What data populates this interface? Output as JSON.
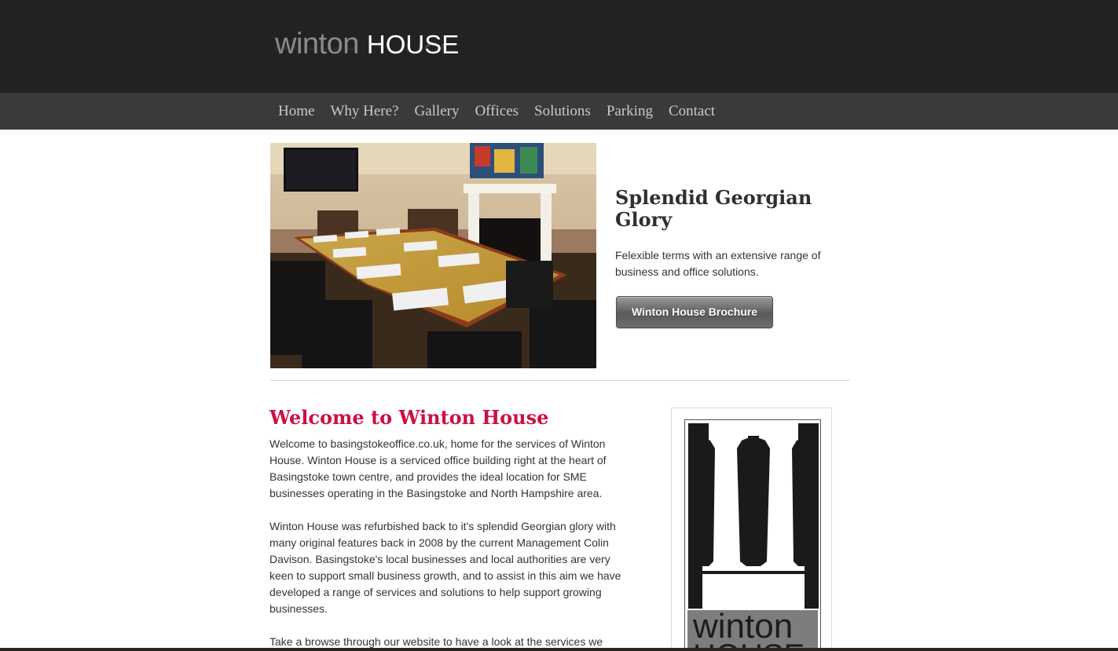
{
  "header": {
    "logo_word1": "winton",
    "logo_word2": "HOUSE"
  },
  "nav": {
    "items": [
      "Home",
      "Why Here?",
      "Gallery",
      "Offices",
      "Solutions",
      "Parking",
      "Contact"
    ]
  },
  "hero": {
    "title": "Splendid Georgian Glory",
    "text": "Felexible terms with an extensive range of business and office solutions.",
    "button_label": "Winton House Brochure"
  },
  "welcome": {
    "title": "Welcome to Winton House",
    "paragraph1": "Welcome to basingstokeoffice.co.uk, home for the services of Winton House. Winton House is a serviced office building right at the heart of Basingstoke town centre, and provides the ideal location for SME businesses operating in the Basingstoke and North Hampshire area.",
    "paragraph2": "Winton House was refurbished back to it's splendid Georgian glory with many original features back in 2008 by the current Management Colin Davison. Basingstoke's local businesses and local authorities are very keen to support small business growth, and to assist in this aim we have developed a range of services and solutions to help support growing businesses.",
    "paragraph3": "Take a browse through our website to have a look at the services we"
  },
  "side_logo": {
    "word1": "winton",
    "word2": "HOUSE"
  },
  "colors": {
    "header_bg": "#222222",
    "nav_bg": "#3a3a3a",
    "accent": "#cc0f45"
  }
}
